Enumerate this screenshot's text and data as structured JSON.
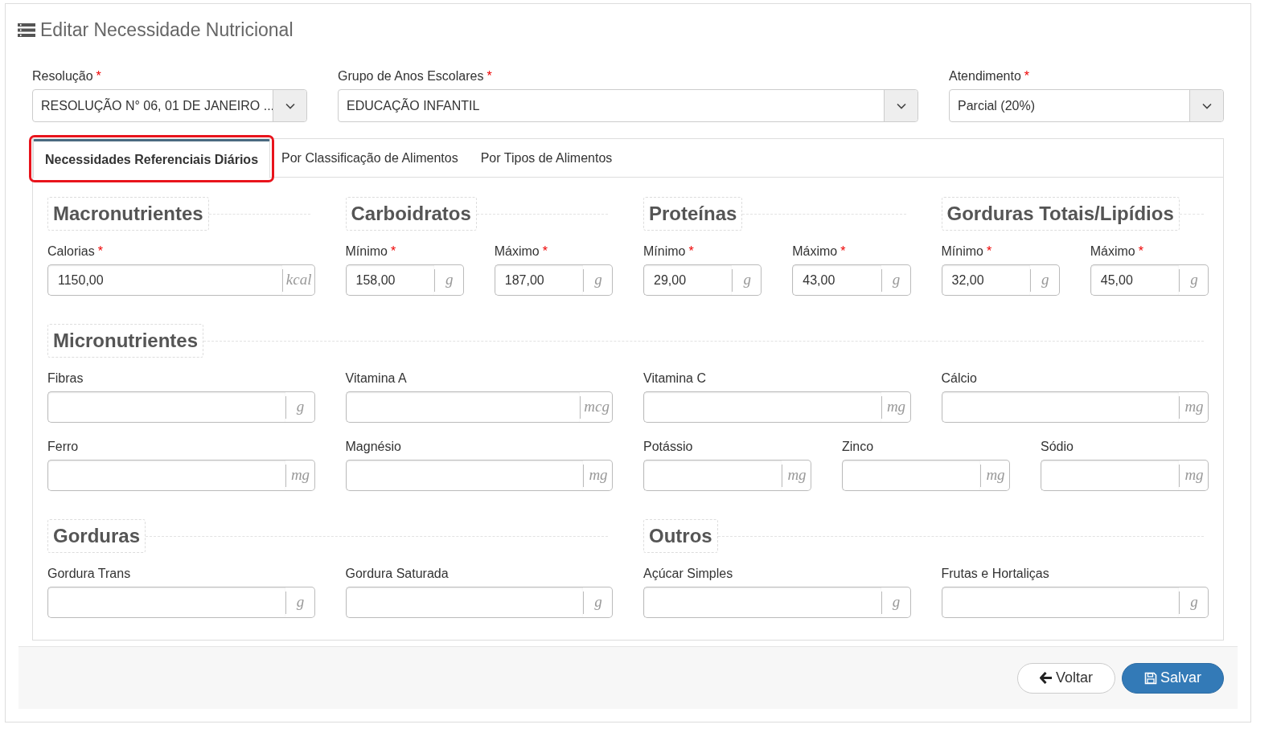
{
  "title": "Editar Necessidade Nutricional",
  "selects": [
    {
      "label": "Resolução",
      "required_mark": "*",
      "value": "RESOLUÇÃO N° 06, 01 DE JANEIRO ..."
    },
    {
      "label": "Grupo de Anos Escolares",
      "required_mark": "*",
      "value": "EDUCAÇÃO INFANTIL"
    },
    {
      "label": "Atendimento",
      "required_mark": "*",
      "value": "Parcial (20%)"
    }
  ],
  "tabs": [
    {
      "label": "Necessidades Referenciais Diários",
      "selected": true,
      "highlighted": true
    },
    {
      "label": "Por Classificação de Alimentos",
      "selected": false,
      "highlighted": false
    },
    {
      "label": "Por Tipos de Alimentos",
      "selected": false,
      "highlighted": false
    }
  ],
  "section_rows": [
    [
      {
        "title": "Macronutrientes",
        "field_rows": [
          [
            {
              "label": "Calorias",
              "required_mark": "*",
              "value": "1150,00",
              "unit": "kcal"
            }
          ]
        ]
      },
      {
        "title": "Carboidratos",
        "field_rows": [
          [
            {
              "label": "Mínimo",
              "required_mark": "*",
              "value": "158,00",
              "unit": "g"
            },
            {
              "label": "Máximo",
              "required_mark": "*",
              "value": "187,00",
              "unit": "g"
            }
          ]
        ]
      },
      {
        "title": "Proteínas",
        "field_rows": [
          [
            {
              "label": "Mínimo",
              "required_mark": "*",
              "value": "29,00",
              "unit": "g"
            },
            {
              "label": "Máximo",
              "required_mark": "*",
              "value": "43,00",
              "unit": "g"
            }
          ]
        ]
      },
      {
        "title": "Gorduras Totais/Lipídios",
        "field_rows": [
          [
            {
              "label": "Mínimo",
              "required_mark": "*",
              "value": "32,00",
              "unit": "g"
            },
            {
              "label": "Máximo",
              "required_mark": "*",
              "value": "45,00",
              "unit": "g"
            }
          ]
        ]
      }
    ],
    [
      {
        "title": "Micronutrientes",
        "field_rows": [
          [
            {
              "label": "Fibras",
              "unit": "g"
            },
            {
              "label": "Vitamina A",
              "unit": "mcg"
            },
            {
              "label": "Vitamina C",
              "unit": "mg"
            },
            {
              "label": "Cálcio",
              "unit": "mg"
            }
          ],
          [
            {
              "label": "Ferro",
              "unit": "mg"
            },
            {
              "label": "Magnésio",
              "unit": "mg"
            },
            {
              "label": "Potássio",
              "unit": "mg"
            },
            {
              "label": "Zinco",
              "unit": "mg"
            },
            {
              "label": "Sódio",
              "unit": "mg"
            }
          ]
        ]
      }
    ],
    [
      {
        "title": "Gorduras",
        "field_rows": [
          [
            {
              "label": "Gordura Trans",
              "unit": "g"
            },
            {
              "label": "Gordura Saturada",
              "unit": "g"
            }
          ]
        ]
      },
      {
        "title": "Outros",
        "field_rows": [
          [
            {
              "label": "Açúcar Simples",
              "unit": "g"
            },
            {
              "label": "Frutas e Hortaliças",
              "unit": "g"
            }
          ]
        ]
      }
    ]
  ],
  "buttons": [
    {
      "kind": "back",
      "label": "Voltar"
    },
    {
      "kind": "save",
      "label": "Salvar"
    }
  ]
}
